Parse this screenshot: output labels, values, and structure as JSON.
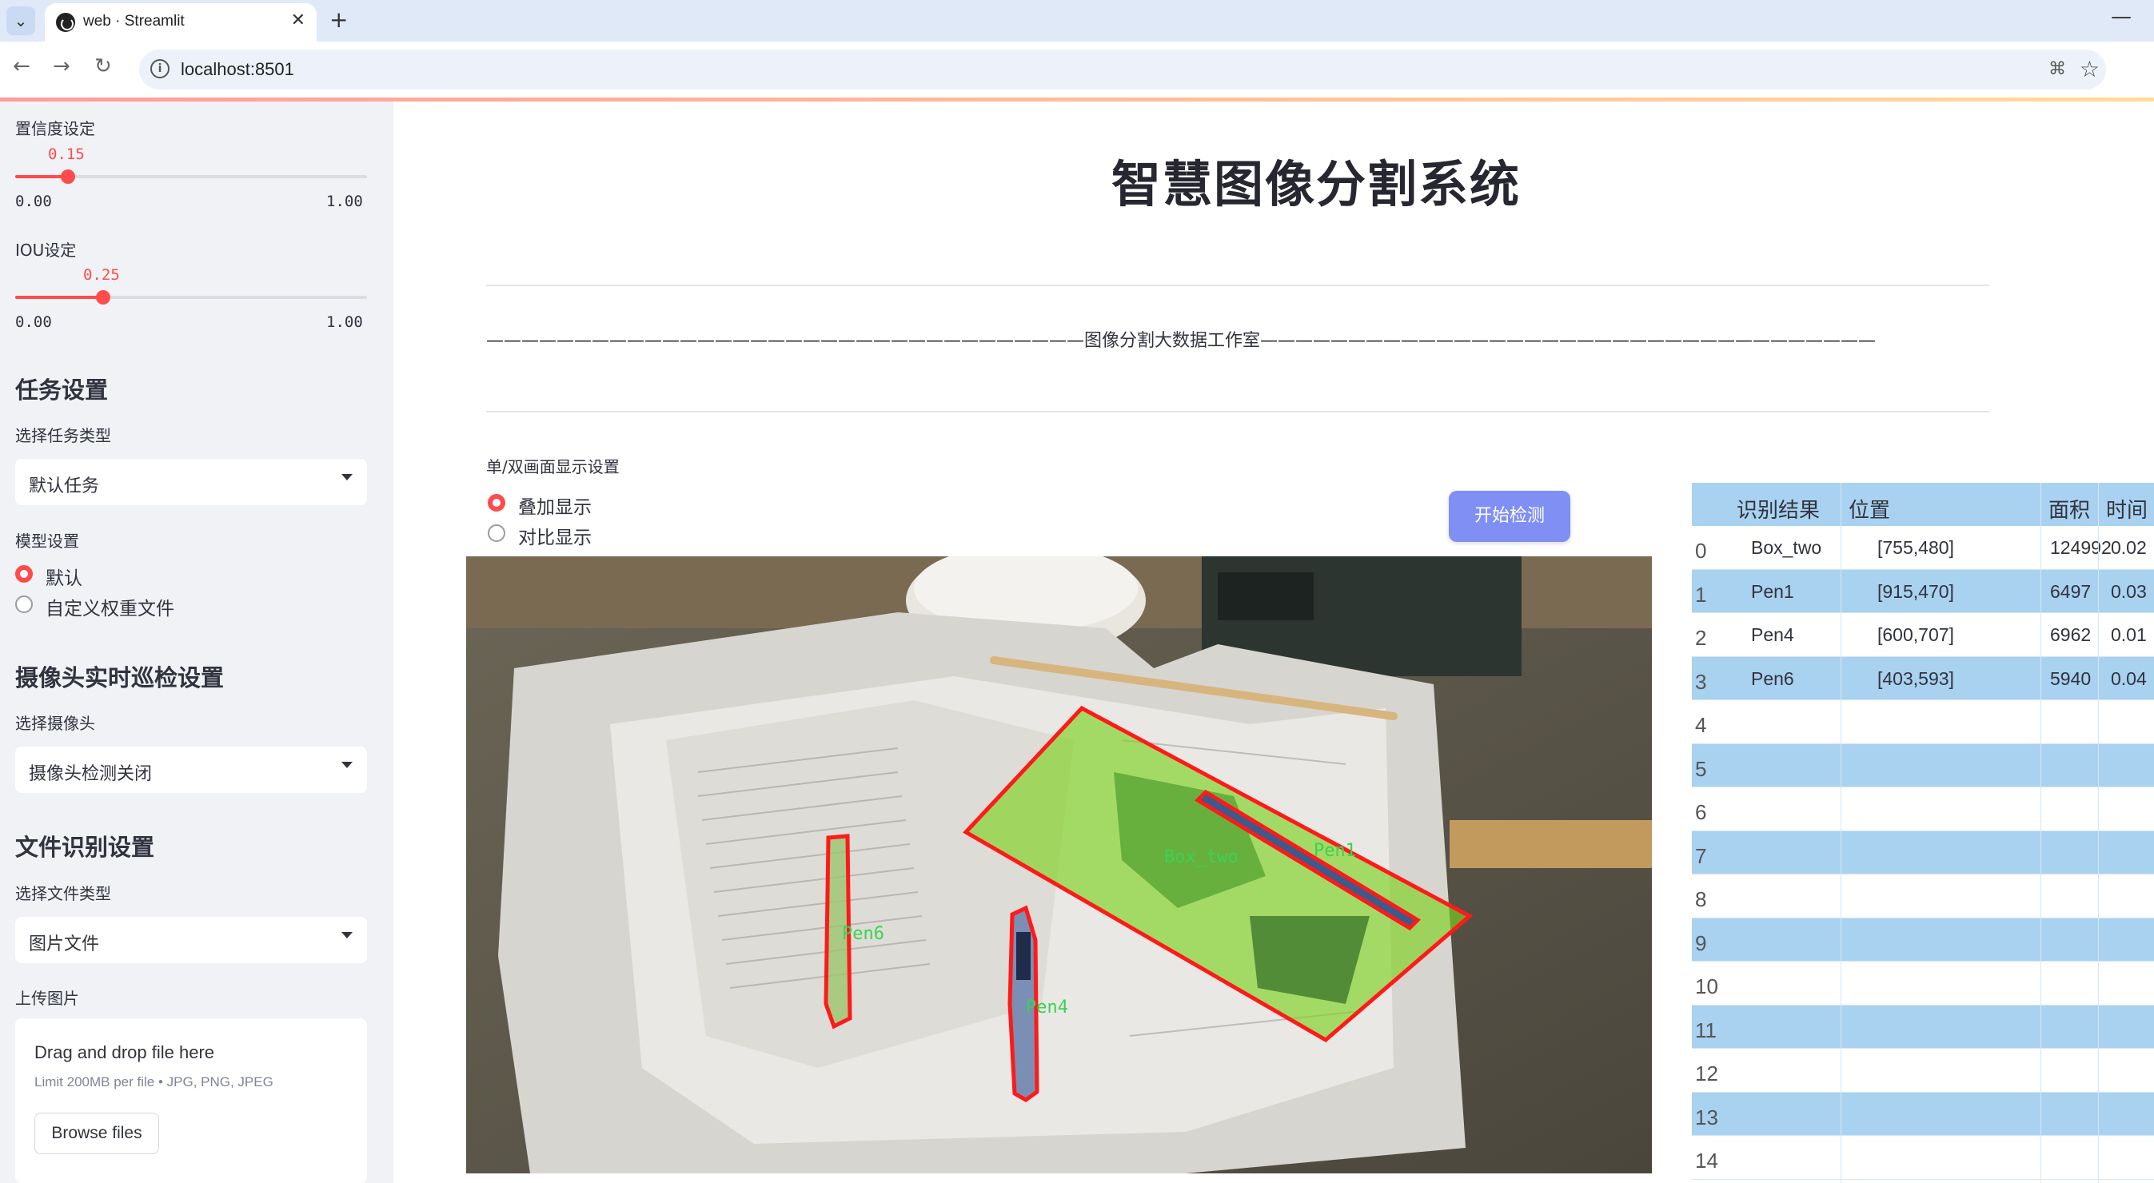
{
  "browser": {
    "tab_title": "web · Streamlit",
    "url": "localhost:8501"
  },
  "sidebar": {
    "confidence": {
      "label": "置信度设定",
      "value": "0.15",
      "min": "0.00",
      "max": "1.00",
      "fraction": 0.15
    },
    "iou": {
      "label": "IOU设定",
      "value": "0.25",
      "min": "0.00",
      "max": "1.00",
      "fraction": 0.25
    },
    "task_section": {
      "title": "任务设置",
      "select_label": "选择任务类型",
      "selected": "默认任务"
    },
    "model_section": {
      "label": "模型设置",
      "options": [
        "默认",
        "自定义权重文件"
      ],
      "selected_index": 0
    },
    "camera_section": {
      "title": "摄像头实时巡检设置",
      "select_label": "选择摄像头",
      "selected": "摄像头检测关闭"
    },
    "file_section": {
      "title": "文件识别设置",
      "select_label": "选择文件类型",
      "selected": "图片文件"
    },
    "upload": {
      "label": "上传图片",
      "drop_text": "Drag and drop file here",
      "limit_text": "Limit 200MB per file • JPG, PNG, JPEG",
      "browse_label": "Browse files"
    }
  },
  "main": {
    "title": "智慧图像分割系统",
    "divider_text": "——————————————————————————————————图像分割大数据工作室———————————————————————————————————",
    "display_label": "单/双画面显示设置",
    "display_options": [
      "叠加显示",
      "对比显示"
    ],
    "display_selected_index": 0,
    "start_button": "开始检测"
  },
  "detections_overlay": [
    {
      "label": "Box_two"
    },
    {
      "label": "Pen1"
    },
    {
      "label": "Pen4"
    },
    {
      "label": "Pen6"
    }
  ],
  "results_table": {
    "columns": [
      "识别结果",
      "位置",
      "面积",
      "时间"
    ],
    "rows": [
      {
        "index": "0",
        "result": "Box_two",
        "position": "[755,480]",
        "area": "124992",
        "time": "0.02"
      },
      {
        "index": "1",
        "result": "Pen1",
        "position": "[915,470]",
        "area": "6497",
        "time": "0.03"
      },
      {
        "index": "2",
        "result": "Pen4",
        "position": "[600,707]",
        "area": "6962",
        "time": "0.01"
      },
      {
        "index": "3",
        "result": "Pen6",
        "position": "[403,593]",
        "area": "5940",
        "time": "0.04"
      },
      {
        "index": "4"
      },
      {
        "index": "5"
      },
      {
        "index": "6"
      },
      {
        "index": "7"
      },
      {
        "index": "8"
      },
      {
        "index": "9"
      },
      {
        "index": "10"
      },
      {
        "index": "11"
      },
      {
        "index": "12"
      },
      {
        "index": "13"
      },
      {
        "index": "14"
      }
    ]
  },
  "colors": {
    "accent": "#ff4b4b",
    "button": "#7f8ff4",
    "table_header": "#a9d1f0",
    "mask": "#7ed321",
    "outline": "#ff0000"
  }
}
